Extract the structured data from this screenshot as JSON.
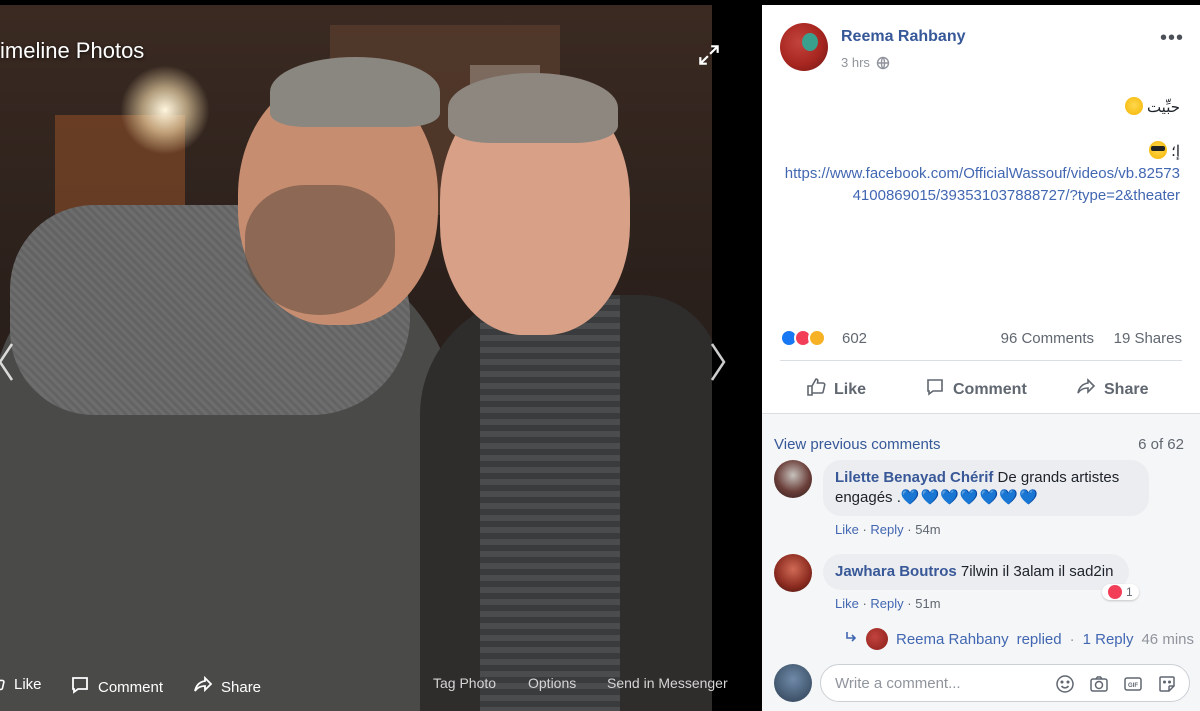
{
  "viewer": {
    "title": "imeline Photos",
    "actions": {
      "like": "Like",
      "comment": "Comment",
      "share": "Share"
    },
    "links": {
      "tag_photo": "Tag Photo",
      "options": "Options",
      "send_messenger": "Send in Messenger"
    }
  },
  "post": {
    "author": "Reema Rahbany",
    "time": "3 hrs",
    "text_line1": "حبِّيت",
    "text_line2": "إ؛",
    "link": "https://www.facebook.com/OfficialWassouf/videos/vb.825734100869015/393531037888727/?type=2&theater",
    "reactions_count": "602",
    "comments_count": "96 Comments",
    "shares_count": "19 Shares",
    "actions": {
      "like": "Like",
      "comment": "Comment",
      "share": "Share"
    }
  },
  "comments": {
    "view_previous": "View previous comments",
    "page_indicator": "6 of 62",
    "items": [
      {
        "name": "Lilette Benayad Chérif",
        "text_a": "De grands artistes",
        "text_b": "engagés .",
        "hearts": "💙💙💙💙💙💙💙",
        "like": "Like",
        "reply": "Reply",
        "time": "54m"
      },
      {
        "name": "Jawhara Boutros",
        "text_a": "7ilwin il 3alam il sad2in",
        "reaction_count": "1",
        "like": "Like",
        "reply": "Reply",
        "time": "51m"
      }
    ],
    "reply_row": {
      "name": "Reema Rahbany",
      "action": "replied",
      "count": "1 Reply",
      "time": "46 mins"
    }
  },
  "composer": {
    "placeholder": "Write a comment..."
  },
  "colors": {
    "link": "#365899",
    "accent": "#4267b2",
    "panel_bg": "#ffffff",
    "comments_bg": "#f5f6f7"
  },
  "icons": [
    "expand-icon",
    "chevron-left-icon",
    "chevron-right-icon",
    "like-icon",
    "comment-icon",
    "share-icon",
    "globe-icon",
    "more-icon",
    "emoji-icon",
    "camera-icon",
    "gif-icon",
    "sticker-icon"
  ]
}
